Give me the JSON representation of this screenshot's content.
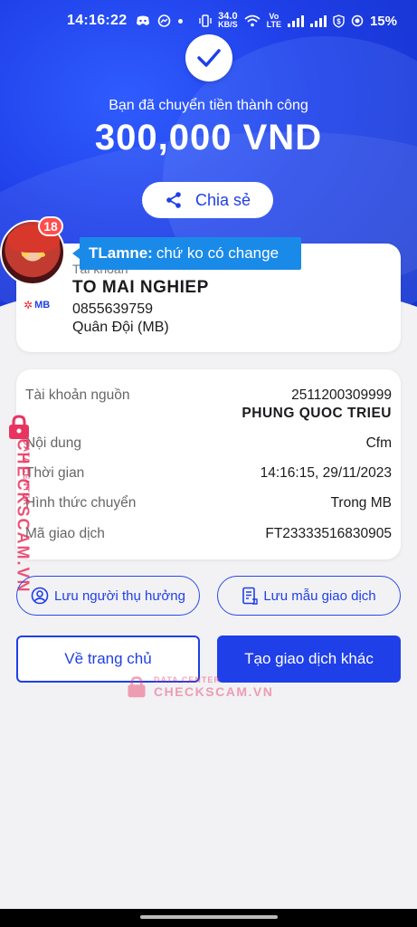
{
  "status_bar": {
    "time": "14:16:22",
    "net_speed_value": "34.0",
    "net_speed_unit": "KB/S",
    "volte_top": "Vo",
    "volte_mid": "LTE",
    "battery": "15%"
  },
  "header": {
    "success_text": "Bạn đã chuyển tiền thành công",
    "amount": "300,000 VND",
    "share_label": "Chia sẻ"
  },
  "recipient": {
    "label": "Tài khoản",
    "name": "TO MAI NGHIEP",
    "account_number": "0855639759",
    "bank": "Quân Đội (MB)",
    "bank_logo": "MB"
  },
  "overlay": {
    "unread_count": "18",
    "chat_sender": "TLamne:",
    "chat_message": "chứ ko có change"
  },
  "details": {
    "source_label": "Tài khoản nguồn",
    "source_account": "2511200309999",
    "source_name": "PHUNG QUOC TRIEU",
    "content_label": "Nội dung",
    "content_value": "Cfm",
    "time_label": "Thời gian",
    "time_value": "14:16:15, 29/11/2023",
    "method_label": "Hình thức chuyển",
    "method_value": "Trong MB",
    "txid_label": "Mã giao dịch",
    "txid_value": "FT23333516830905"
  },
  "actions": {
    "save_recipient": "Lưu người thụ hưởng",
    "save_template": "Lưu mẫu giao dịch",
    "home": "Về trang chủ",
    "new_transaction": "Tạo giao dịch khác"
  },
  "watermark": {
    "side_small": "DATA CENTER",
    "side_big": "CHECKSCAM.VN",
    "center_small": "DATA CENTER",
    "center_big": "CHECKSCAM.VN"
  },
  "colors": {
    "primary": "#1f3fe8",
    "watermark": "#e8355f",
    "chat_bubble": "#1a8ae8",
    "badge": "#ff4d4d"
  }
}
